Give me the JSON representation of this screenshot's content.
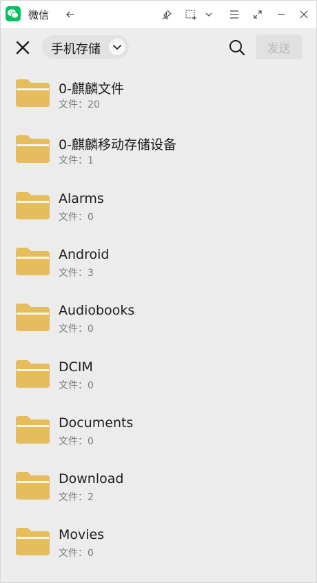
{
  "window": {
    "app_title": "微信"
  },
  "toolbar": {
    "storage_label": "手机存储",
    "send_label": "发送"
  },
  "files": {
    "count_prefix": "文件：",
    "items": [
      {
        "name": "0-麒麟文件",
        "count": "20"
      },
      {
        "name": "0-麒麟移动存储设备",
        "count": "1"
      },
      {
        "name": "Alarms",
        "count": "0"
      },
      {
        "name": "Android",
        "count": "3"
      },
      {
        "name": "Audiobooks",
        "count": "0"
      },
      {
        "name": "DCIM",
        "count": "0"
      },
      {
        "name": "Documents",
        "count": "0"
      },
      {
        "name": "Download",
        "count": "2"
      },
      {
        "name": "Movies",
        "count": "0"
      }
    ]
  },
  "colors": {
    "app_green": "#07c160",
    "folder_yellow": "#e5bd5c",
    "folder_tab": "#f8f4ea",
    "send_disabled_text": "#b8b8b8"
  },
  "icons": [
    "wechat-logo-icon",
    "back-arrow-icon",
    "pin-icon",
    "screenshot-icon",
    "chevron-down-icon",
    "menu-icon",
    "expand-icon",
    "minimize-icon",
    "close-icon",
    "search-icon",
    "folder-icon"
  ]
}
